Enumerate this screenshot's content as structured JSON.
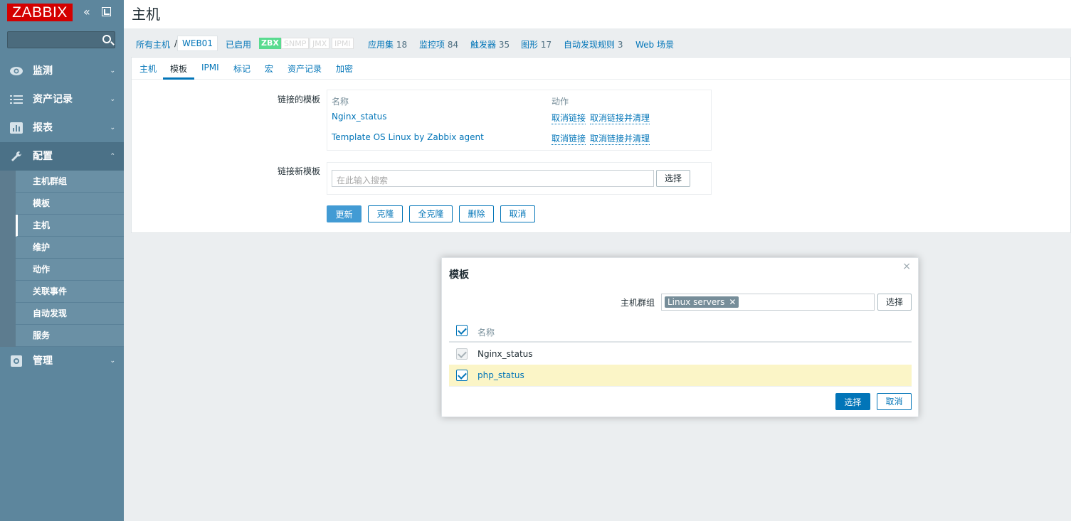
{
  "sidebar": {
    "logo": "ZABBIX",
    "collapse_icon": "collapse-icon",
    "search_placeholder": "",
    "menu": [
      {
        "label": "监测",
        "icon": "eye-icon"
      },
      {
        "label": "资产记录",
        "icon": "list-icon"
      },
      {
        "label": "报表",
        "icon": "bar-chart-icon"
      },
      {
        "label": "配置",
        "icon": "wrench-icon"
      },
      {
        "label": "管理",
        "icon": "gear-icon"
      }
    ],
    "submenu": [
      "主机群组",
      "模板",
      "主机",
      "维护",
      "动作",
      "关联事件",
      "自动发现",
      "服务"
    ],
    "active_submenu": "主机"
  },
  "header": {
    "title": "主机"
  },
  "host_nav": {
    "all_hosts": "所有主机",
    "separator": "/",
    "host": "WEB01",
    "status": "已启用",
    "availability": [
      "ZBX",
      "SNMP",
      "JMX",
      "IPMI"
    ],
    "applications": "应用集",
    "applications_count": "18",
    "items": "监控项",
    "items_count": "84",
    "triggers": "触发器",
    "triggers_count": "35",
    "graphs": "图形",
    "graphs_count": "17",
    "discovery": "自动发现规则",
    "discovery_count": "3",
    "web": "Web 场景"
  },
  "tabs": [
    "主机",
    "模板",
    "IPMI",
    "标记",
    "宏",
    "资产记录",
    "加密"
  ],
  "active_tab": "模板",
  "form": {
    "linked_label": "链接的模板",
    "col_name": "名称",
    "col_action": "动作",
    "linked": [
      {
        "name": "Nginx_status",
        "unlink": "取消链接",
        "unlink_clear": "取消链接并清理"
      },
      {
        "name": "Template OS Linux by Zabbix agent",
        "unlink": "取消链接",
        "unlink_clear": "取消链接并清理"
      }
    ],
    "new_label": "链接新模板",
    "new_placeholder": "在此输入搜索",
    "select": "选择",
    "buttons": {
      "update": "更新",
      "clone": "克隆",
      "full_clone": "全克隆",
      "delete": "删除",
      "cancel": "取消"
    }
  },
  "dialog": {
    "title": "模板",
    "close": "×",
    "group_label": "主机群组",
    "group_chip": "Linux servers",
    "chip_remove": "✕",
    "group_select": "选择",
    "col_name": "名称",
    "rows": [
      {
        "name": "Nginx_status",
        "checked": true,
        "disabled": true
      },
      {
        "name": "php_status",
        "checked": true,
        "disabled": false
      }
    ],
    "select_button": "选择",
    "cancel_button": "取消"
  }
}
